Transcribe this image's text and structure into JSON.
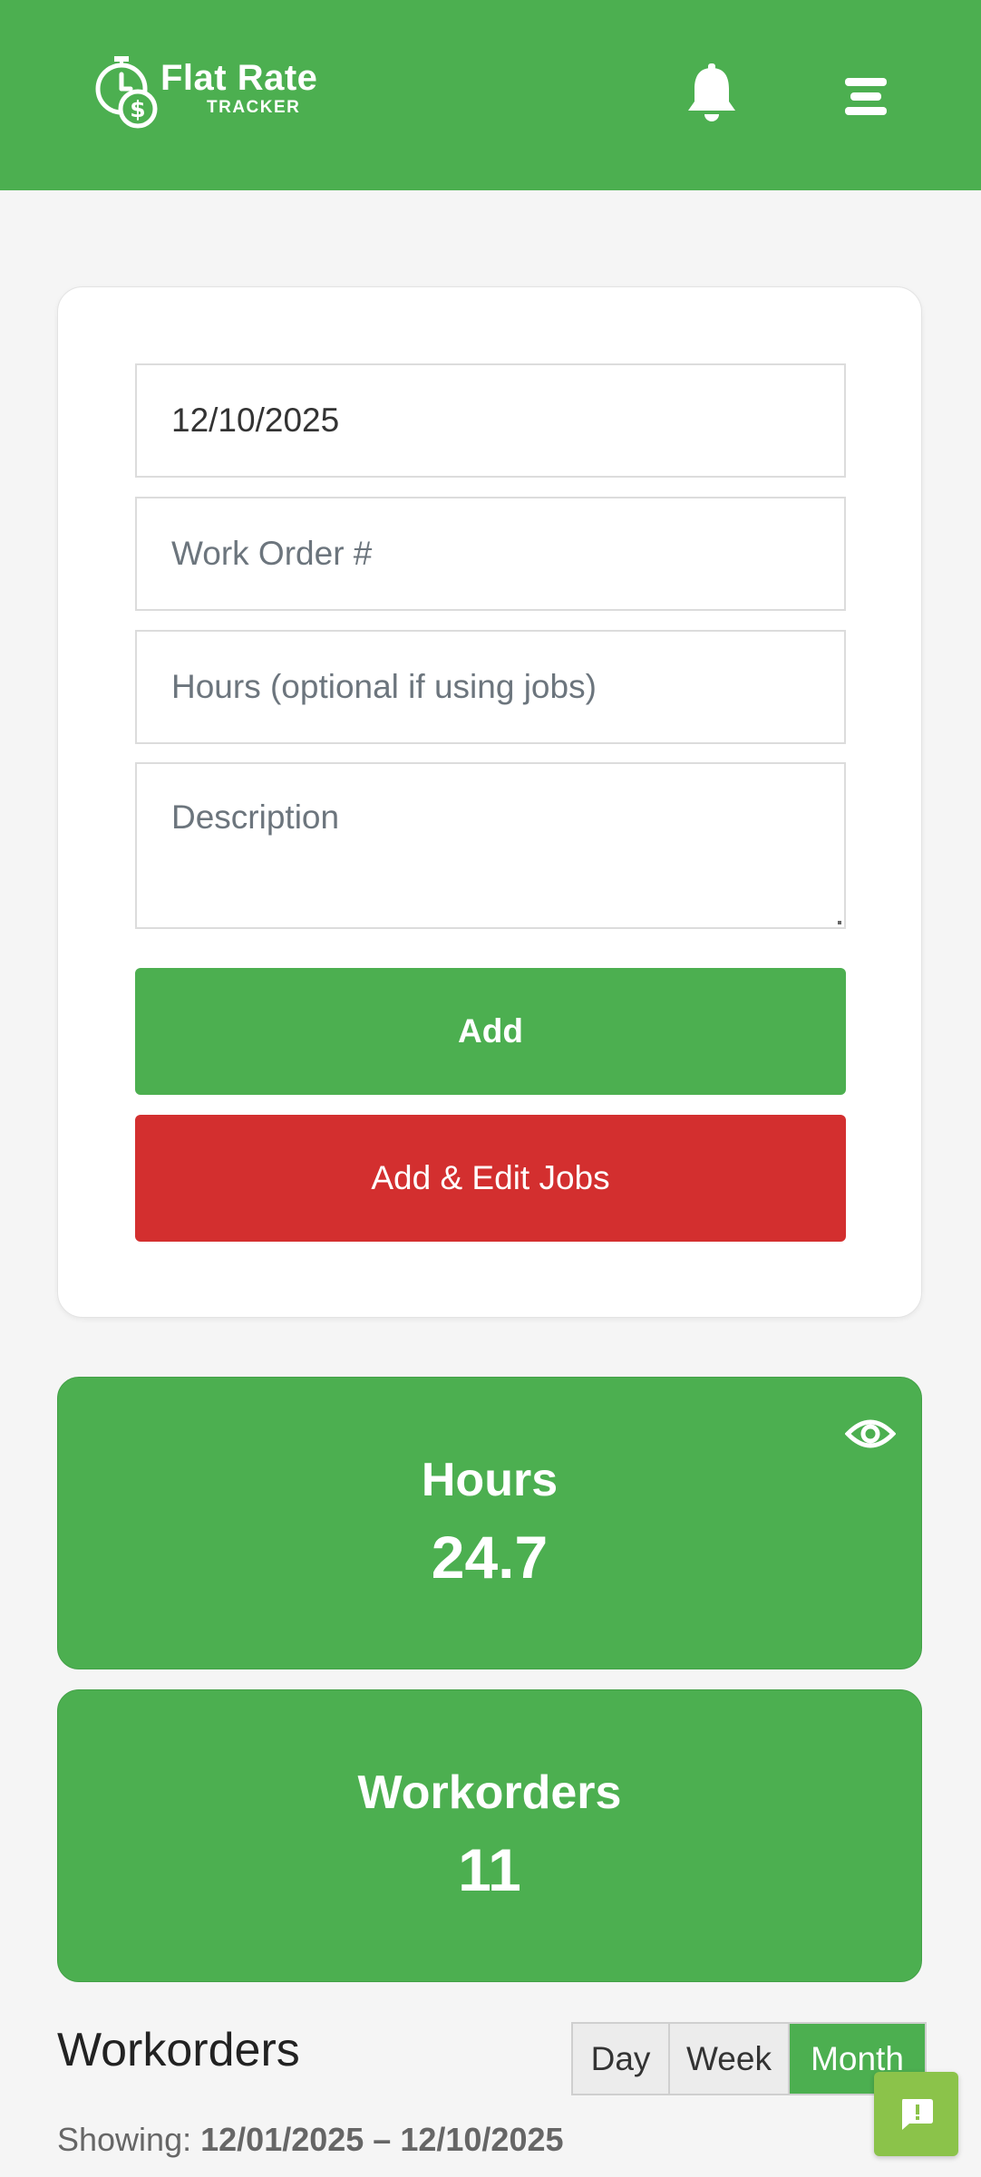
{
  "app": {
    "title": "Flat Rate",
    "subtitle": "TRACKER"
  },
  "header": {
    "icons": [
      "stopwatch-dollar-logo-icon",
      "bell-icon",
      "menu-icon"
    ]
  },
  "form": {
    "date_value": "12/10/2025",
    "work_order_placeholder": "Work Order #",
    "hours_placeholder": "Hours (optional if using jobs)",
    "description_placeholder": "Description",
    "add_label": "Add",
    "add_edit_jobs_label": "Add & Edit Jobs"
  },
  "stats": [
    {
      "label": "Hours",
      "value": "24.7"
    },
    {
      "label": "Workorders",
      "value": "11"
    }
  ],
  "workorders": {
    "title": "Workorders",
    "ranges": [
      "Day",
      "Week",
      "Month"
    ],
    "selected_range": "Month",
    "showing_label": "Showing:",
    "showing_range": "12/01/2025 – 12/10/2025"
  },
  "colors": {
    "primary": "#4caf50",
    "danger": "#d32f2f",
    "feedback": "#8bc34a",
    "background": "#f5f5f5"
  }
}
